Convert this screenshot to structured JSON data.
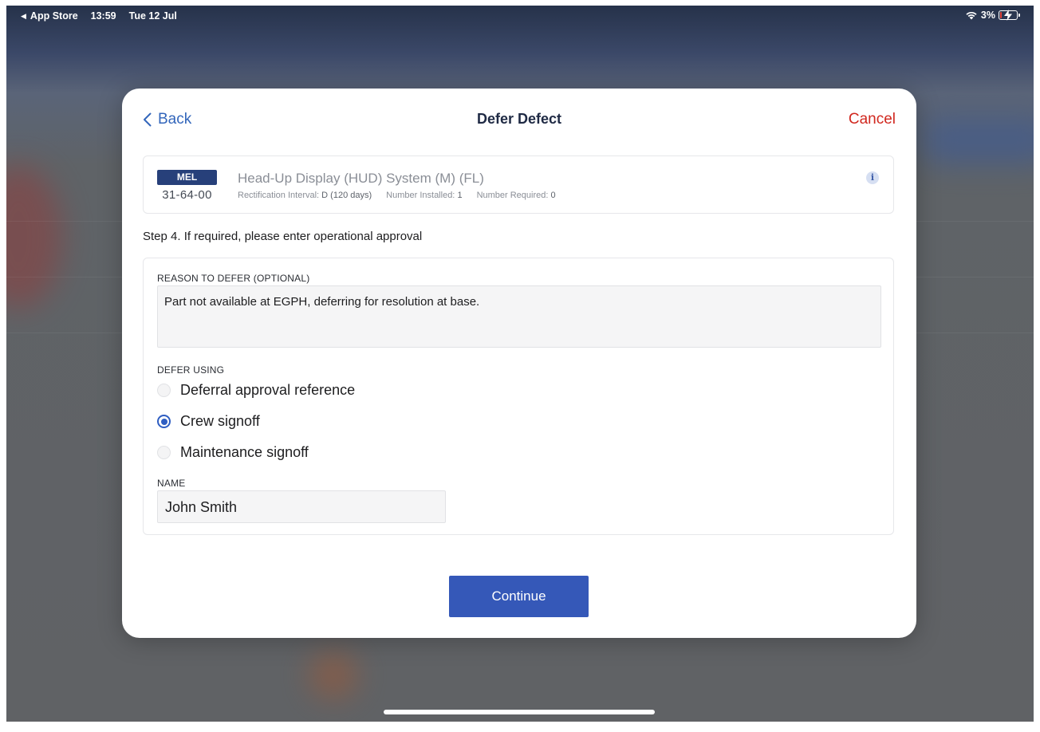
{
  "status_bar": {
    "back_app": "App Store",
    "time": "13:59",
    "date": "Tue 12 Jul",
    "battery": "3%"
  },
  "nav": {
    "back_label": "Back",
    "title": "Defer Defect",
    "cancel_label": "Cancel"
  },
  "mel": {
    "badge": "MEL",
    "code": "31-64-00",
    "title": "Head-Up Display (HUD) System (M) (FL)",
    "rectification_label": "Rectification Interval:",
    "rectification_value": "D (120 days)",
    "installed_label": "Number Installed:",
    "installed_value": "1",
    "required_label": "Number Required:",
    "required_value": "0"
  },
  "step_label": "Step 4. If required, please enter operational approval",
  "form": {
    "reason_label": "REASON TO DEFER (OPTIONAL)",
    "reason_value": "Part not available at EGPH, deferring for resolution at base.",
    "defer_using_label": "DEFER USING",
    "options": [
      {
        "label": "Deferral approval reference",
        "selected": false
      },
      {
        "label": "Crew signoff",
        "selected": true
      },
      {
        "label": "Maintenance signoff",
        "selected": false
      }
    ],
    "name_label": "NAME",
    "name_value": "John Smith"
  },
  "continue_label": "Continue",
  "colors": {
    "accent": "#3558b8",
    "cancel": "#d1281f",
    "mel_badge": "#27407a"
  }
}
